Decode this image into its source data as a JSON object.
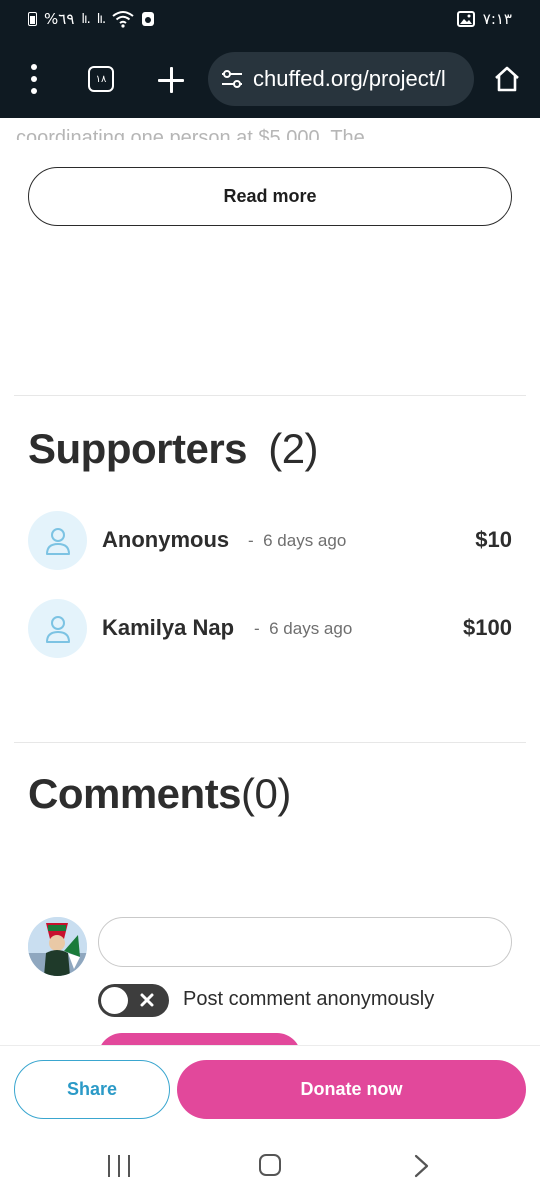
{
  "status_bar": {
    "battery_text": "%٦٩",
    "signal_1": "lı.",
    "signal_2": "lı.",
    "time": "٧:١٣",
    "icons": [
      "battery-icon",
      "signal-icon",
      "wifi-icon",
      "shield-icon",
      "image-icon"
    ]
  },
  "browser": {
    "tabs_count": "١٨",
    "url": "chuffed.org/project/l",
    "icons": [
      "menu-icon",
      "tabs-icon",
      "new-tab-icon",
      "site-info-icon",
      "home-icon"
    ]
  },
  "page": {
    "cut_text": "coordinating one person at $5,000. The",
    "read_more_label": "Read more",
    "supporters": {
      "title": "Supporters",
      "count": "(2)",
      "items": [
        {
          "name": "Anonymous",
          "separator": "-",
          "time": "6 days ago",
          "amount": "$10"
        },
        {
          "name": "Kamilya Nap",
          "separator": "-",
          "time": "6 days ago",
          "amount": "$100"
        }
      ]
    },
    "comments": {
      "title": "Comments",
      "count": "(0)",
      "input_placeholder": "",
      "anonymous_toggle_label": "Post comment anonymously",
      "anonymous_toggle_on": false
    }
  },
  "footer": {
    "share_label": "Share",
    "donate_label": "Donate now"
  },
  "colors": {
    "brand_pink": "#e2489b",
    "share_blue": "#2b9ac7",
    "status_bg": "#0f1a22",
    "avatar_bg": "#e4f3fb"
  }
}
